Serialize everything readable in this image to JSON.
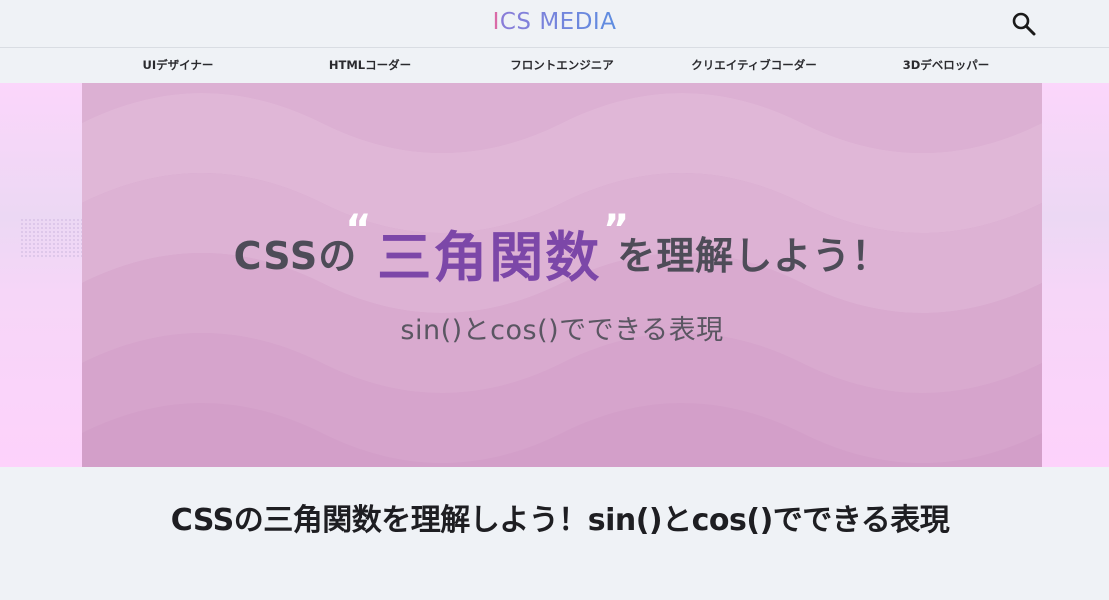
{
  "header": {
    "logo_initial": "I",
    "logo_rest": "CS MEDIA",
    "search_icon": "search-icon"
  },
  "nav": {
    "items": [
      {
        "label": "UIデザイナー"
      },
      {
        "label": "HTMLコーダー"
      },
      {
        "label": "フロントエンジニア"
      },
      {
        "label": "クリエイティブコーダー"
      },
      {
        "label": "3Dデベロッパー"
      }
    ]
  },
  "hero": {
    "title_prefix": "CSSの",
    "title_highlight": "三角関数",
    "title_suffix": "を理解しよう！",
    "quote_open": "“",
    "quote_close": "”",
    "subtitle": "sin()とcos()でできる表現",
    "colors": {
      "background": "#d9a9cf",
      "highlight": "#7c47a8",
      "text": "#4e4c58"
    }
  },
  "article": {
    "title": "CSSの三角関数を理解しよう！sin()とcos()でできる表現"
  }
}
